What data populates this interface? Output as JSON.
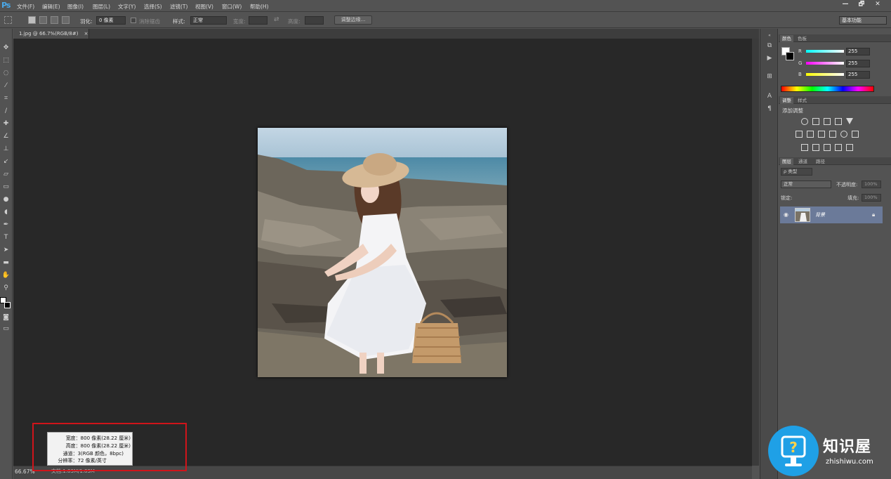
{
  "app": {
    "logo": "Ps"
  },
  "menu": [
    "文件(F)",
    "编辑(E)",
    "图像(I)",
    "图层(L)",
    "文字(Y)",
    "选择(S)",
    "滤镜(T)",
    "视图(V)",
    "窗口(W)",
    "帮助(H)"
  ],
  "window_controls": [
    "—",
    "🗗",
    "✕"
  ],
  "options_bar": {
    "feather_label": "羽化:",
    "feather_value": "0 像素",
    "antialias_label": "消除锯齿",
    "style_label": "样式:",
    "style_value": "正常",
    "width_label": "宽度:",
    "height_label": "高度:",
    "refine_edge_label": "调整边缘...",
    "workspace_value": "基本功能"
  },
  "document": {
    "tab_title": "1.jpg @ 66.7%(RGB/8#)",
    "tab_close": "×",
    "zoom": "66.67%",
    "doc_size": "文档:1.83M/1.83M"
  },
  "info_popup": {
    "width_line": "宽度：800 像素(28.22 厘米)",
    "height_line": "高度：800 像素(28.22 厘米)",
    "channels_line": "通道：3(RGB 颜色，8bpc)",
    "resolution_line": "分辨率：72 像素/英寸"
  },
  "color_panel": {
    "tabs": [
      "颜色",
      "色板"
    ],
    "channels": [
      {
        "label": "R",
        "value": "255"
      },
      {
        "label": "G",
        "value": "255"
      },
      {
        "label": "B",
        "value": "255"
      }
    ]
  },
  "adjustments_panel": {
    "tabs": [
      "调整",
      "样式"
    ],
    "title": "添加调整"
  },
  "layers_panel": {
    "tabs": [
      "图层",
      "通道",
      "路径"
    ],
    "kind_filter": "ρ 类型",
    "blend_mode": "正常",
    "opacity_label": "不透明度:",
    "opacity_value": "100%",
    "lock_label": "锁定:",
    "fill_label": "填充:",
    "fill_value": "100%",
    "layers": [
      {
        "name": "背景",
        "visible": true,
        "locked": true
      }
    ]
  },
  "watermark": {
    "title": "知识屋",
    "url": "zhishiwu.com"
  },
  "colors": {
    "accent_blue": "#1fa0e6",
    "highlight_red": "#d0141a",
    "selected_layer": "#6b7a99"
  }
}
